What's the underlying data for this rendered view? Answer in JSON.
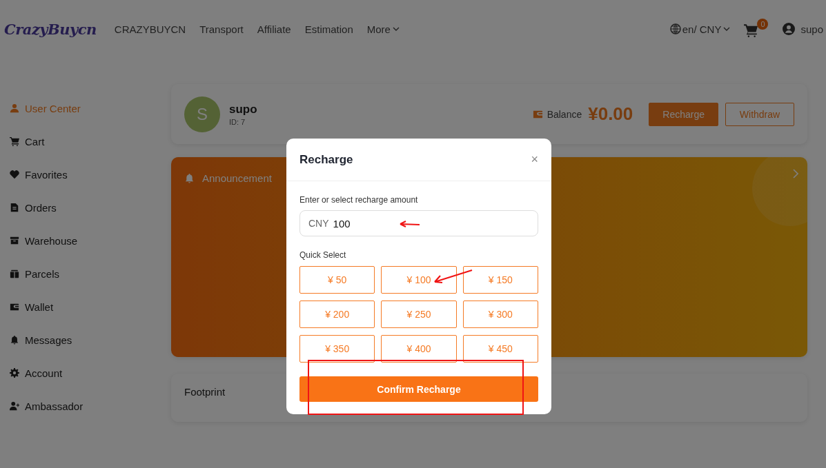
{
  "header": {
    "logo": "CrazyBuycn",
    "nav": [
      "CRAZYBUYCN",
      "Transport",
      "Affiliate",
      "Estimation",
      "More"
    ],
    "locale": "en/ CNY",
    "cart_count": "0",
    "user": "supo"
  },
  "sidebar": {
    "items": [
      {
        "label": "User Center",
        "selected": true
      },
      {
        "label": "Cart",
        "selected": false
      },
      {
        "label": "Favorites",
        "selected": false
      },
      {
        "label": "Orders",
        "selected": false
      },
      {
        "label": "Warehouse",
        "selected": false
      },
      {
        "label": "Parcels",
        "selected": false
      },
      {
        "label": "Wallet",
        "selected": false
      },
      {
        "label": "Messages",
        "selected": false
      },
      {
        "label": "Account",
        "selected": false
      },
      {
        "label": "Ambassador",
        "selected": false
      }
    ]
  },
  "profile": {
    "avatar": "S",
    "name": "supo",
    "id": "ID: 7",
    "balance_label": "Balance",
    "balance": "¥0.00",
    "buttons": [
      "Recharge",
      "Withdraw"
    ]
  },
  "announcement": {
    "title": "Announcement"
  },
  "footprint": {
    "title": "Footprint"
  },
  "modal": {
    "title": "Recharge",
    "close": "×",
    "amount_label": "Enter or select recharge amount",
    "currency": "CNY",
    "value": "100",
    "quick_select_label": "Quick Select",
    "options": [
      "¥ 50",
      "¥ 100",
      "¥ 150",
      "¥ 200",
      "¥ 250",
      "¥ 300",
      "¥ 350",
      "¥ 400",
      "¥ 450"
    ],
    "confirm": "Confirm Recharge"
  }
}
